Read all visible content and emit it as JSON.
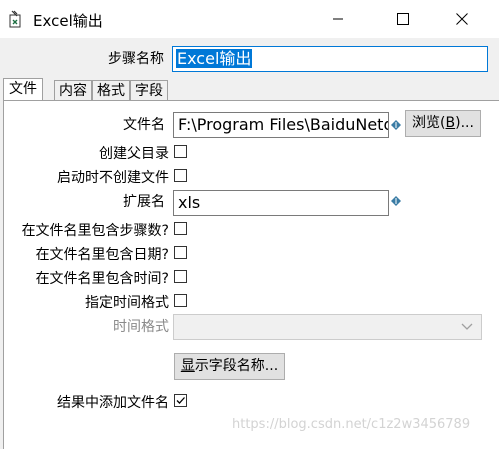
{
  "window": {
    "title": "Excel输出",
    "controls": [
      "minimize",
      "maximize",
      "close"
    ]
  },
  "step_name": {
    "label": "步骤名称",
    "value": "Excel输出"
  },
  "tabs": [
    {
      "label": "文件",
      "active": true
    },
    {
      "label": "内容",
      "active": false
    },
    {
      "label": "格式",
      "active": false
    },
    {
      "label": "字段",
      "active": false
    }
  ],
  "file_tab": {
    "filename": {
      "label": "文件名",
      "value": "F:\\Program Files\\BaiduNetdis",
      "browse_label": "浏览(",
      "browse_mnemonic": "B",
      "browse_suffix": ")..."
    },
    "create_parent_dir": {
      "label": "创建父目录",
      "checked": false
    },
    "no_create_on_start": {
      "label": "启动时不创建文件",
      "checked": false
    },
    "extension": {
      "label": "扩展名",
      "value": "xls"
    },
    "include_stepnr": {
      "label": "在文件名里包含步骤数?",
      "checked": false
    },
    "include_date": {
      "label": "在文件名里包含日期?",
      "checked": false
    },
    "include_time": {
      "label": "在文件名里包含时间?",
      "checked": false
    },
    "specify_time_format": {
      "label": "指定时间格式",
      "checked": false
    },
    "time_format": {
      "label": "时间格式",
      "value": "",
      "disabled": true
    },
    "show_fields_button": {
      "mnemonic": "显",
      "rest": "示字段名称..."
    },
    "add_to_result": {
      "label": "结果中添加文件名",
      "checked": true
    }
  },
  "watermark": "https://blog.csdn.net/c1z2w3456789"
}
